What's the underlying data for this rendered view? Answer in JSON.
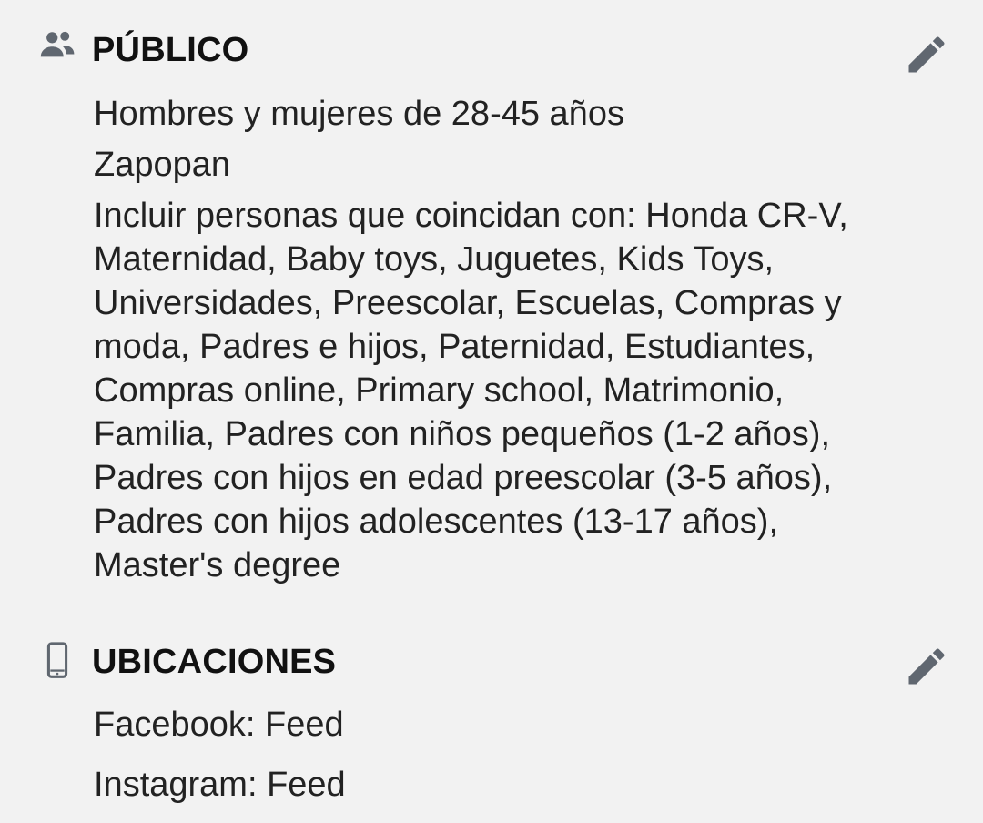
{
  "publico": {
    "icon": "people-icon",
    "title": "PÚBLICO",
    "edit_icon": "pencil-icon",
    "age_gender": "Hombres y mujeres de 28-45 años",
    "location": "Zapopan",
    "interests_lines": [
      "Incluir personas que coincidan con: Honda CR-V,",
      "Maternidad, Baby toys, Juguetes, Kids Toys,",
      "Universidades, Preescolar, Escuelas, Compras y",
      "moda, Padres e hijos, Paternidad, Estudiantes,",
      "Compras online, Primary school, Matrimonio,",
      "Familia, Padres con niños pequeños (1-2 años),",
      "Padres con hijos en edad preescolar (3-5 años),",
      "Padres con hijos adolescentes (13-17 años),",
      "Master's degree"
    ]
  },
  "ubicaciones": {
    "icon": "phone-icon",
    "title": "UBICACIONES",
    "edit_icon": "pencil-icon",
    "placements": [
      "Facebook: Feed",
      "Instagram: Feed"
    ]
  },
  "colors": {
    "background": "#f2f2f2",
    "text": "#1c1c1c",
    "icon": "#606770"
  }
}
